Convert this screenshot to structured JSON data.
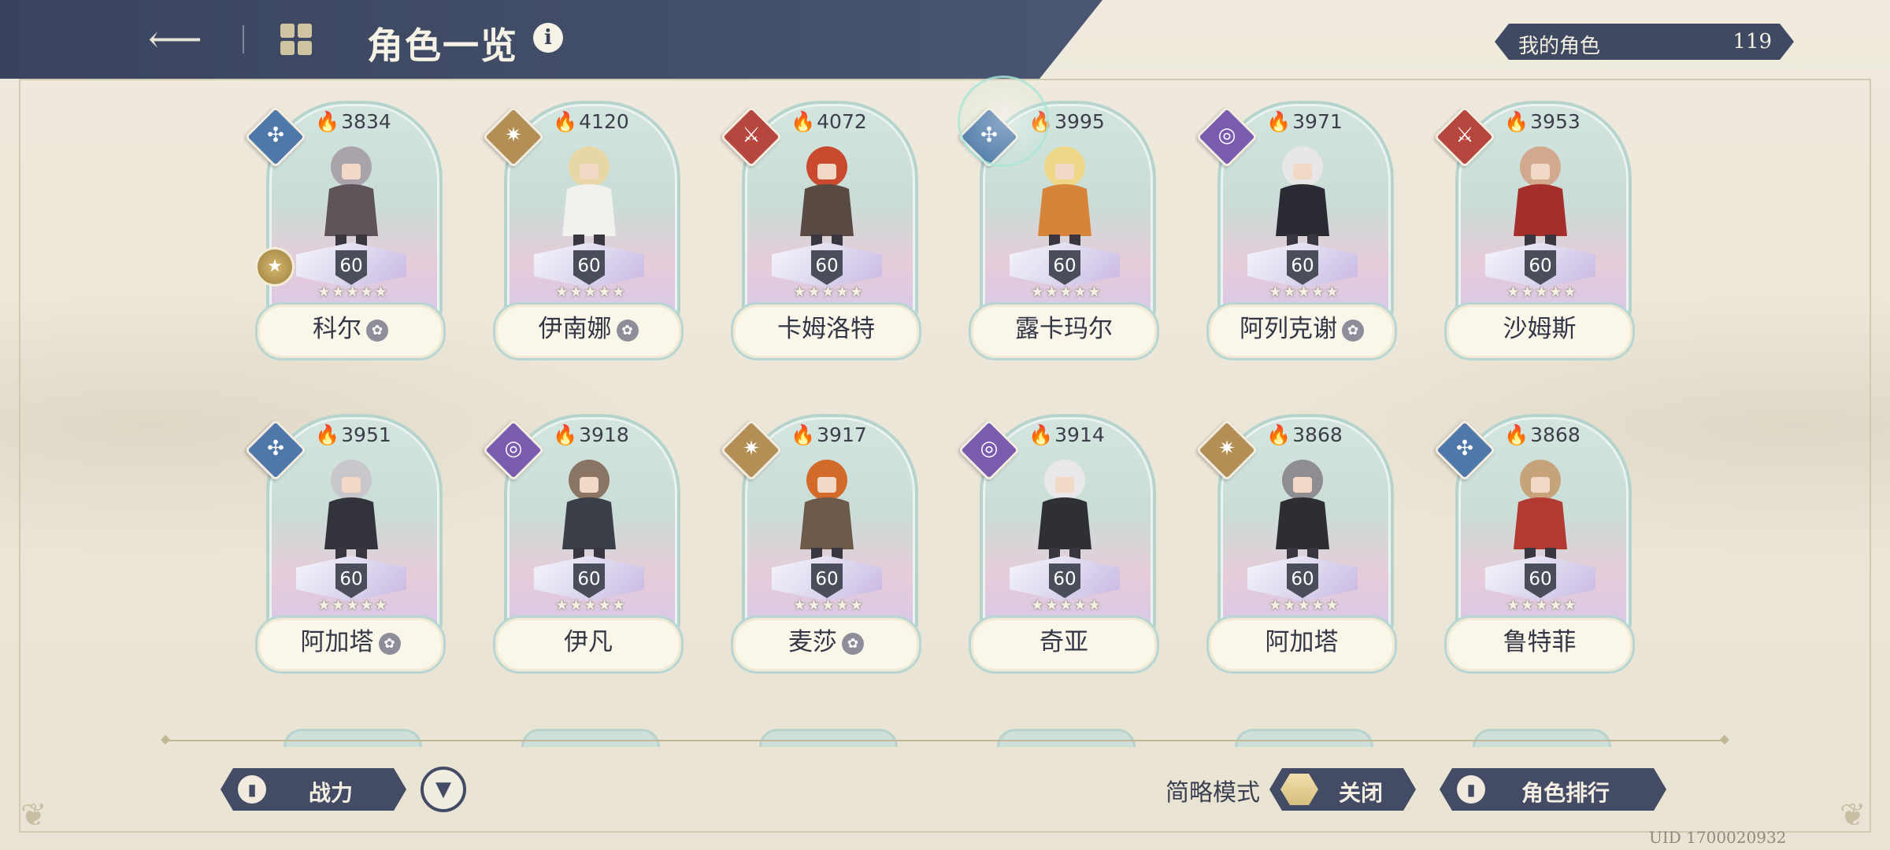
{
  "header": {
    "title": "角色一览",
    "back_icon": "back-arrow-icon",
    "menu_icon": "grid-icon",
    "info_icon": "info-icon"
  },
  "my_characters": {
    "label": "我的角色",
    "count": "119"
  },
  "element_colors": {
    "wind": "#4f78a8",
    "light": "#b38e55",
    "fire": "#b5473f",
    "dark": "#7a5cae"
  },
  "cards": [
    {
      "power": "3834",
      "name": "科尔",
      "level": "60",
      "stars": "★★★★★",
      "element": "wind",
      "badge": true,
      "gold": true
    },
    {
      "power": "4120",
      "name": "伊南娜",
      "level": "60",
      "stars": "★★★★★",
      "element": "light",
      "badge": true
    },
    {
      "power": "4072",
      "name": "卡姆洛特",
      "level": "60",
      "stars": "★★★★★",
      "element": "fire"
    },
    {
      "power": "3995",
      "name": "露卡玛尔",
      "level": "60",
      "stars": "★★★★★",
      "element": "wind"
    },
    {
      "power": "3971",
      "name": "阿列克谢",
      "level": "60",
      "stars": "★★★★★",
      "element": "dark",
      "badge": true
    },
    {
      "power": "3953",
      "name": "沙姆斯",
      "level": "60",
      "stars": "★★★★★",
      "element": "fire"
    },
    {
      "power": "3951",
      "name": "阿加塔",
      "level": "60",
      "stars": "★★★★★",
      "element": "wind",
      "badge": true
    },
    {
      "power": "3918",
      "name": "伊凡",
      "level": "60",
      "stars": "★★★★★",
      "element": "dark"
    },
    {
      "power": "3917",
      "name": "麦莎",
      "level": "60",
      "stars": "★★★★★",
      "element": "light",
      "badge": true
    },
    {
      "power": "3914",
      "name": "奇亚",
      "level": "60",
      "stars": "★★★★★",
      "element": "dark"
    },
    {
      "power": "3868",
      "name": "阿加塔",
      "level": "60",
      "stars": "★★★★★",
      "element": "light"
    },
    {
      "power": "3868",
      "name": "鲁特菲",
      "level": "60",
      "stars": "★★★★★",
      "element": "wind"
    }
  ],
  "footer": {
    "sort_label": "战力",
    "simple_mode_label": "简略模式",
    "toggle_state": "关闭",
    "ranking_label": "角色排行",
    "uid": "UID 1700020932"
  }
}
